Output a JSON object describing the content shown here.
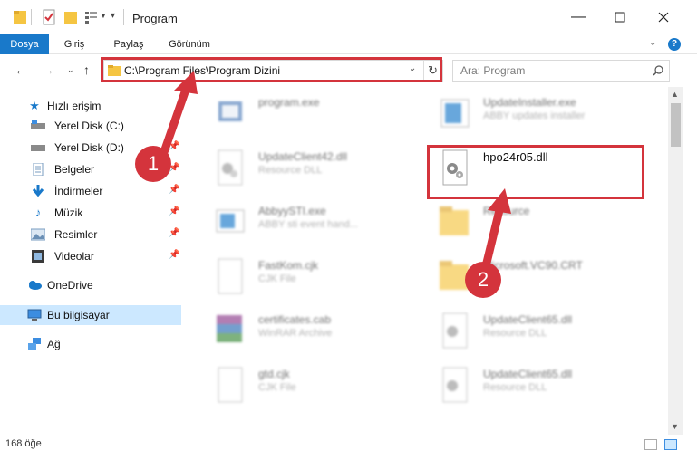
{
  "window": {
    "title": "Program",
    "minimize_icon": "minimize-icon",
    "maximize_icon": "maximize-icon",
    "close_icon": "close-icon"
  },
  "ribbon": {
    "tabs": [
      "Dosya",
      "Giriş",
      "Paylaş",
      "Görünüm"
    ],
    "active": "Dosya"
  },
  "navigation": {
    "address_path": "C:\\Program Files\\Program Dizini",
    "search_placeholder": "Ara: Program"
  },
  "sidebar": {
    "quick_access": "Hızlı erişim",
    "items": [
      {
        "label": "Yerel Disk (C:)",
        "icon": "drive-icon"
      },
      {
        "label": "Yerel Disk (D:)",
        "icon": "drive-icon"
      },
      {
        "label": "Belgeler",
        "icon": "documents-icon"
      },
      {
        "label": "İndirmeler",
        "icon": "download-icon"
      },
      {
        "label": "Müzik",
        "icon": "music-icon"
      },
      {
        "label": "Resimler",
        "icon": "pictures-icon"
      },
      {
        "label": "Videolar",
        "icon": "video-icon"
      }
    ],
    "onedrive": "OneDrive",
    "this_pc": "Bu bilgisayar",
    "network": "Ağ"
  },
  "files": [
    {
      "name": "program.exe",
      "type": ""
    },
    {
      "name": "UpdateInstaller.exe",
      "type": "ABBY updates installer"
    },
    {
      "name": "UpdateClient42.dll",
      "type": "Resource DLL"
    },
    {
      "name": "hpo24r05.dll",
      "type": ""
    },
    {
      "name": "AbbyySTI.exe",
      "type": "ABBY sti event hand..."
    },
    {
      "name": "Resource",
      "type": ""
    },
    {
      "name": "FastKom.cjk",
      "type": "CJK File"
    },
    {
      "name": "Microsoft.VC90.CRT",
      "type": ""
    },
    {
      "name": "certificates.cab",
      "type": "WinRAR Archive"
    },
    {
      "name": "UpdateClient65.dll",
      "type": "Resource DLL"
    },
    {
      "name": "gtd.cjk",
      "type": "CJK File"
    },
    {
      "name": "UpdateClient65.dll",
      "type": "Resource DLL"
    }
  ],
  "annotations": {
    "step1": "1",
    "step2": "2",
    "highlight_color": "#d4343c"
  },
  "status": {
    "item_count": "168 öğe"
  }
}
